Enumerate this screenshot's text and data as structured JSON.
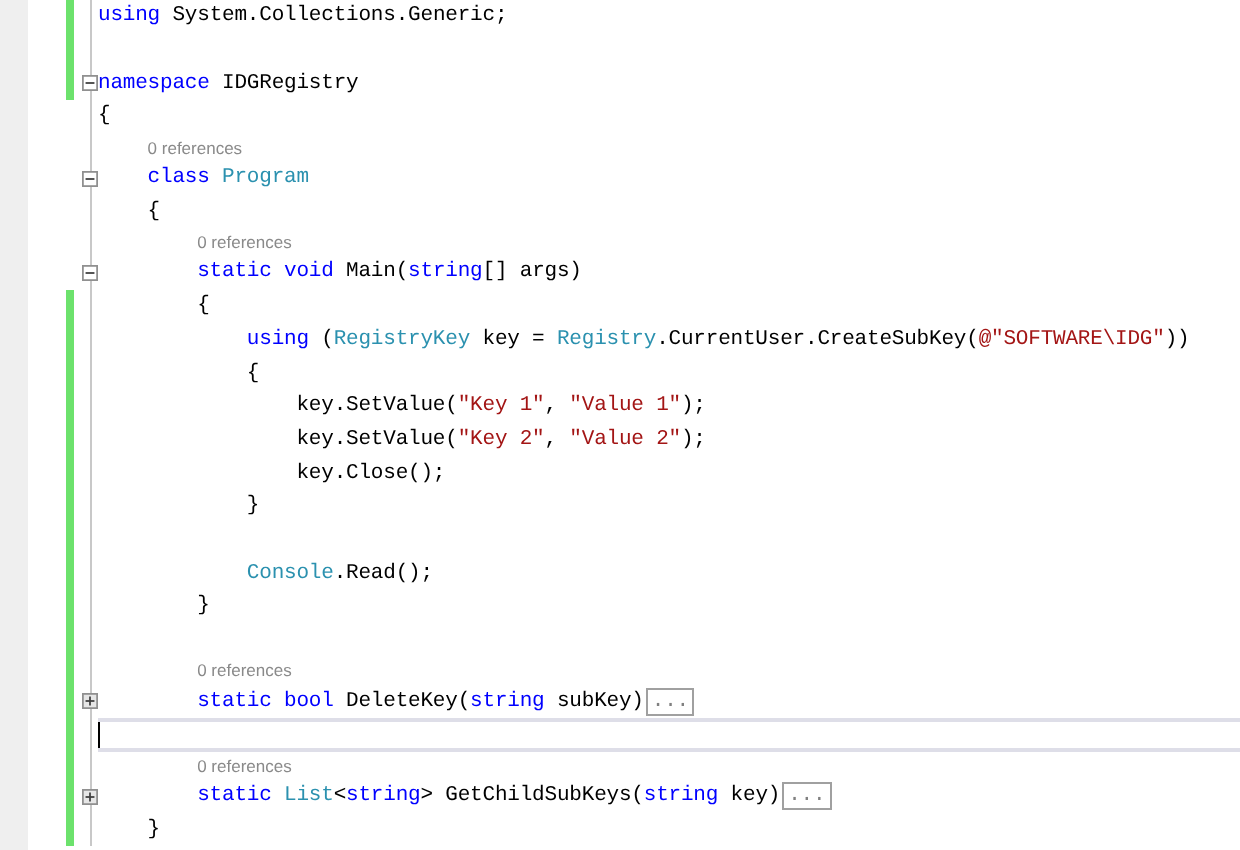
{
  "lines": [
    {
      "kind": "code",
      "changed": true,
      "tokens": [
        {
          "kind": "kw",
          "s": "using"
        },
        {
          "kind": "text",
          "s": " System.Collections.Generic;"
        }
      ]
    },
    {
      "kind": "blank",
      "changed": true
    },
    {
      "kind": "code",
      "changed": true,
      "collapsed": false,
      "tokens": [
        {
          "kind": "kw",
          "s": "namespace"
        },
        {
          "kind": "text",
          "s": " IDGRegistry"
        }
      ]
    },
    {
      "kind": "code",
      "changed": false,
      "tokens": [
        {
          "kind": "text",
          "s": "{"
        }
      ]
    },
    {
      "kind": "code",
      "changed": false,
      "lens": "0 references",
      "collapsed": false,
      "tokens": [
        {
          "kind": "kw",
          "s": "    class "
        },
        {
          "kind": "type",
          "s": "Program"
        }
      ]
    },
    {
      "kind": "code",
      "changed": false,
      "tokens": [
        {
          "kind": "text",
          "s": "    {"
        }
      ]
    },
    {
      "kind": "code",
      "changed": false,
      "lens": "0 references",
      "collapsed": false,
      "tokens": [
        {
          "kind": "kw",
          "s": "        static void"
        },
        {
          "kind": "text",
          "s": " Main("
        },
        {
          "kind": "kw",
          "s": "string"
        },
        {
          "kind": "text",
          "s": "[] args)"
        }
      ]
    },
    {
      "kind": "code",
      "changed": true,
      "tokens": [
        {
          "kind": "text",
          "s": "        {"
        }
      ]
    },
    {
      "kind": "code",
      "changed": true,
      "tokens": [
        {
          "kind": "kw",
          "s": "            using"
        },
        {
          "kind": "text",
          "s": " ("
        },
        {
          "kind": "type",
          "s": "RegistryKey"
        },
        {
          "kind": "text",
          "s": " key = "
        },
        {
          "kind": "type",
          "s": "Registry"
        },
        {
          "kind": "text",
          "s": ".CurrentUser.CreateSubKey("
        },
        {
          "kind": "str",
          "s": "@\"SOFTWARE\\IDG\""
        },
        {
          "kind": "text",
          "s": "))"
        }
      ]
    },
    {
      "kind": "code",
      "changed": true,
      "tokens": [
        {
          "kind": "text",
          "s": "            {"
        }
      ]
    },
    {
      "kind": "code",
      "changed": true,
      "tokens": [
        {
          "kind": "text",
          "s": "                key.SetValue("
        },
        {
          "kind": "str",
          "s": "\"Key 1\""
        },
        {
          "kind": "text",
          "s": ", "
        },
        {
          "kind": "str",
          "s": "\"Value 1\""
        },
        {
          "kind": "text",
          "s": ");"
        }
      ]
    },
    {
      "kind": "code",
      "changed": true,
      "tokens": [
        {
          "kind": "text",
          "s": "                key.SetValue("
        },
        {
          "kind": "str",
          "s": "\"Key 2\""
        },
        {
          "kind": "text",
          "s": ", "
        },
        {
          "kind": "str",
          "s": "\"Value 2\""
        },
        {
          "kind": "text",
          "s": ");"
        }
      ]
    },
    {
      "kind": "code",
      "changed": true,
      "tokens": [
        {
          "kind": "text",
          "s": "                key.Close();"
        }
      ]
    },
    {
      "kind": "code",
      "changed": true,
      "tokens": [
        {
          "kind": "text",
          "s": "            }"
        }
      ]
    },
    {
      "kind": "blank",
      "changed": true
    },
    {
      "kind": "code",
      "changed": true,
      "tokens": [
        {
          "kind": "type",
          "s": "            Console"
        },
        {
          "kind": "text",
          "s": ".Read();"
        }
      ]
    },
    {
      "kind": "code",
      "changed": true,
      "tokens": [
        {
          "kind": "text",
          "s": "        }"
        }
      ]
    },
    {
      "kind": "blank",
      "changed": true
    },
    {
      "kind": "code",
      "changed": true,
      "lens": "0 references",
      "collapsed": true,
      "ellipsis": "...",
      "tokens": [
        {
          "kind": "kw",
          "s": "        static bool"
        },
        {
          "kind": "text",
          "s": " DeleteKey("
        },
        {
          "kind": "kw",
          "s": "string"
        },
        {
          "kind": "text",
          "s": " subKey)"
        }
      ]
    },
    {
      "kind": "blank",
      "changed": true,
      "caret": true
    },
    {
      "kind": "code",
      "changed": true,
      "lens": "0 references",
      "collapsed": true,
      "ellipsis": "...",
      "tokens": [
        {
          "kind": "kw",
          "s": "        static "
        },
        {
          "kind": "type",
          "s": "List"
        },
        {
          "kind": "text",
          "s": "<"
        },
        {
          "kind": "kw",
          "s": "string"
        },
        {
          "kind": "text",
          "s": "> GetChildSubKeys("
        },
        {
          "kind": "kw",
          "s": "string"
        },
        {
          "kind": "text",
          "s": " key)"
        }
      ]
    },
    {
      "kind": "code",
      "changed": true,
      "tokens": [
        {
          "kind": "text",
          "s": "    }"
        }
      ]
    }
  ]
}
